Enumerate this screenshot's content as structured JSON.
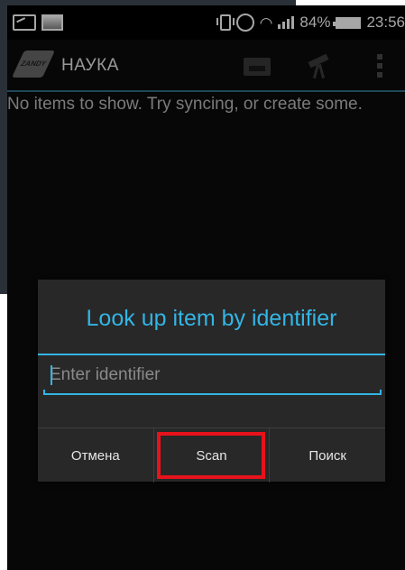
{
  "status_bar": {
    "battery": "84%",
    "time": "23:56"
  },
  "action_bar": {
    "title": "НАУКА",
    "logo_text": "ZANDY"
  },
  "empty_message": "No items to show. Try syncing, or create some.",
  "dialog": {
    "title": "Look up item by identifier",
    "input_placeholder": "Enter identifier",
    "input_value": "",
    "buttons": {
      "cancel": "Отмена",
      "scan": "Scan",
      "search": "Поиск"
    }
  },
  "colors": {
    "accent": "#33b5e5",
    "highlight_box": "#e8121b",
    "dialog_bg": "#282828",
    "screen_bg": "#0b0b0b"
  }
}
